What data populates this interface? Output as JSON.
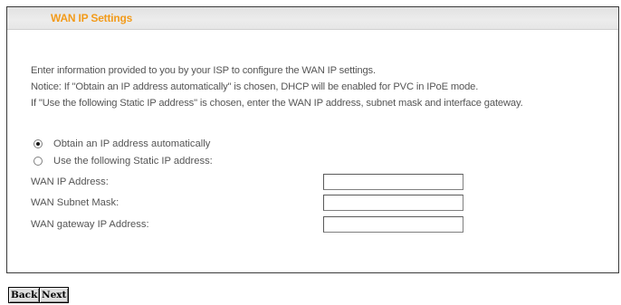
{
  "panel": {
    "title": "WAN IP Settings"
  },
  "description": {
    "line1": "Enter information provided to you by your ISP to configure the WAN IP settings.",
    "line2": "Notice: If \"Obtain an IP address automatically\" is chosen, DHCP will be enabled for PVC in IPoE mode.",
    "line3": "If \"Use the following Static IP address\" is chosen, enter the WAN IP address, subnet mask and interface gateway."
  },
  "ip_mode": {
    "selected": "auto",
    "options": [
      {
        "id": "auto",
        "label": "Obtain an IP address automatically",
        "checked": true
      },
      {
        "id": "static",
        "label": "Use the following Static IP address:",
        "checked": false
      }
    ]
  },
  "fields": {
    "wan_ip": {
      "label": "WAN IP Address:",
      "value": ""
    },
    "subnet_mask": {
      "label": "WAN Subnet Mask:",
      "value": ""
    },
    "gateway": {
      "label": "WAN gateway IP Address:",
      "value": ""
    }
  },
  "buttons": {
    "back_label": "Back",
    "next_label": "Next"
  },
  "colors": {
    "title": "#f29b1b",
    "text": "#555555",
    "title_bar": "#e6e6e6",
    "frame_border": "#3a3a3a"
  }
}
